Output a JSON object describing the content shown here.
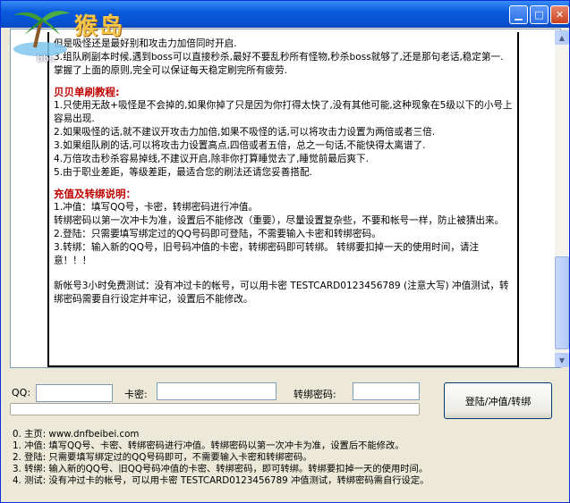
{
  "window": {
    "logo_text": "猴岛",
    "logo_subtext": "bbs.",
    "min_icon": "minimize-icon",
    "max_icon": "maximize-icon",
    "close_icon": "close-icon"
  },
  "content": {
    "intro": [
      "但是吸怪还是最好别和攻击力加倍同时开启.",
      "3.组队刷副本时候,遇到boss可以直接秒杀,最好不要乱秒所有怪物,秒杀boss就够了,还是那句老话,稳定第一.",
      "掌握了上面的原则,完全可以保证每天稳定刷完所有疲劳."
    ],
    "beibei_title": "贝贝单刷教程:",
    "beibei_items": [
      "1.只使用无敌+吸怪是不会掉的,如果你掉了只是因为你打得太快了,没有其他可能,这种现象在5级以下的小号上容易出现.",
      "2.如果吸怪的话,就不建议开攻击力加倍,如果不吸怪的话,可以将攻击力设置为两倍或者三倍.",
      "3.如果组队刷的话,可以将攻击力设置高点,四倍或者五倍，总之一句话,不能快得太离谱了.",
      "4.万倍攻击秒杀容易掉线,不建议开启,除非你打算睡觉去了,睡觉前最后爽下.",
      "5.由于职业差距，等级差距，最适合您的刷法还请您妥善搭配."
    ],
    "recharge_title": "充值及转绑说明：",
    "recharge_items": [
      "1.冲值：填写QQ号，卡密，转绑密码进行冲值。",
      "转绑密码以第一次冲卡为准，设置后不能修改（重要），尽量设置复杂些，不要和帐号一样，防止被猜出来。",
      "2.登陆：只需要填写绑定过的QQ号码即可登陆，不需要输入卡密和转绑密码。",
      "3.转绑：输入新的QQ号，旧号码冲值的卡密，转绑密码即可转绑。  转绑要扣掉一天的使用时间，请注意！！！"
    ],
    "trial_note": "新帐号3小时免费测试：没有冲过卡的帐号，可以用卡密  TESTCARD0123456789 (注意大写) 冲值测试，转绑密码需要自行设定并牢记，设置后不能修改。"
  },
  "form": {
    "qq_label": "QQ:",
    "qq_value": "",
    "card_label": "卡密:",
    "card_value": "",
    "bind_pwd_label": "转绑密码:",
    "bind_pwd_value": "",
    "submit_label": "登陆/冲值/转绑",
    "progress": 0
  },
  "footer": [
    "0. 主页: www.dnfbeibei.com",
    "1. 冲值: 填写QQ号、卡密、转绑密码进行冲值。转绑密码以第一次冲卡为准，设置后不能修改。",
    "2. 登陆: 只需要填写绑定过的QQ号码即可，不需要输入卡密和转绑密码。",
    "3. 转绑: 输入新的QQ号、旧QQ号码冲值的卡密、转绑密码，即可转绑。转绑要扣掉一天的使用时间。",
    "4. 测试: 没有冲过卡的帐号，可以用卡密 TESTCARD0123456789 冲值测试，转绑密码需自行设定。"
  ]
}
